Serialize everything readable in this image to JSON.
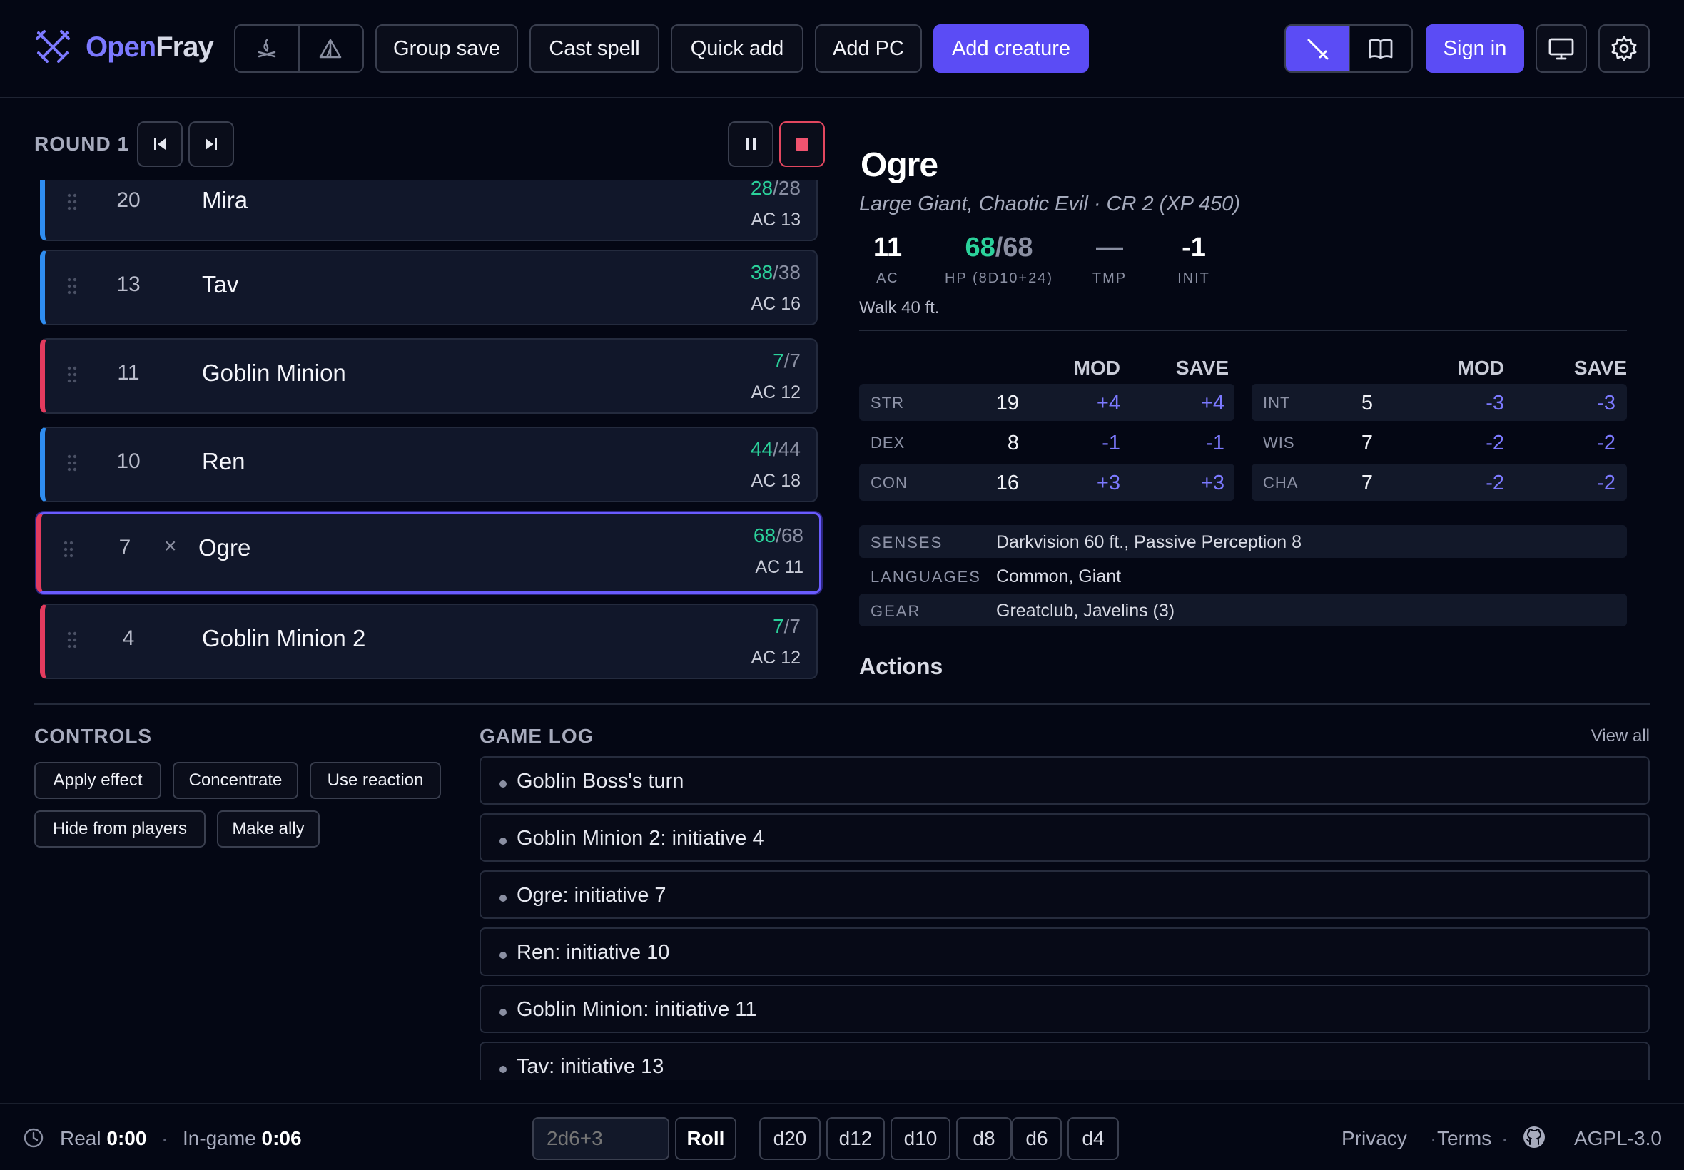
{
  "app": {
    "name_part1": "Open",
    "name_part2": "Fray"
  },
  "header": {
    "group_save": "Group save",
    "cast_spell": "Cast spell",
    "quick_add": "Quick add",
    "add_pc": "Add PC",
    "add_creature": "Add creature",
    "sign_in": "Sign in"
  },
  "tracker": {
    "round_label": "ROUND 1",
    "combatants": [
      {
        "init": "20",
        "name": "Mira",
        "hp": "28",
        "hp_max": "/28",
        "ac": "AC 13",
        "side": "ally"
      },
      {
        "init": "13",
        "name": "Tav",
        "hp": "38",
        "hp_max": "/38",
        "ac": "AC 16",
        "side": "ally"
      },
      {
        "init": "11",
        "name": "Goblin Minion",
        "hp": "7",
        "hp_max": "/7",
        "ac": "AC 12",
        "side": "enemy"
      },
      {
        "init": "10",
        "name": "Ren",
        "hp": "44",
        "hp_max": "/44",
        "ac": "AC 18",
        "side": "ally"
      },
      {
        "init": "7",
        "name": "Ogre",
        "hp": "68",
        "hp_max": "/68",
        "ac": "AC 11",
        "side": "enemy",
        "active": true
      },
      {
        "init": "4",
        "name": "Goblin Minion 2",
        "hp": "7",
        "hp_max": "/7",
        "ac": "AC 12",
        "side": "enemy"
      }
    ],
    "remove_glyph": "×"
  },
  "statblock": {
    "name": "Ogre",
    "subtitle": "Large Giant, Chaotic Evil · CR 2 (XP 450)",
    "ac": "11",
    "ac_label": "AC",
    "hp": "68",
    "hp_max": "/68",
    "hp_label": "HP (8D10+24)",
    "tmp": "—",
    "tmp_label": "TMP",
    "init": "-1",
    "init_label": "INIT",
    "speed": "Walk 40 ft.",
    "mod_header": "MOD",
    "save_header": "SAVE",
    "abilities": [
      {
        "key": "STR",
        "score": "19",
        "mod": "+4",
        "save": "+4"
      },
      {
        "key": "DEX",
        "score": "8",
        "mod": "-1",
        "save": "-1"
      },
      {
        "key": "CON",
        "score": "16",
        "mod": "+3",
        "save": "+3"
      },
      {
        "key": "INT",
        "score": "5",
        "mod": "-3",
        "save": "-3"
      },
      {
        "key": "WIS",
        "score": "7",
        "mod": "-2",
        "save": "-2"
      },
      {
        "key": "CHA",
        "score": "7",
        "mod": "-2",
        "save": "-2"
      }
    ],
    "senses_label": "SENSES",
    "senses": "Darkvision 60 ft., Passive Perception 8",
    "languages_label": "LANGUAGES",
    "languages": "Common, Giant",
    "gear_label": "GEAR",
    "gear": "Greatclub, Javelins (3)",
    "actions_heading": "Actions"
  },
  "controls": {
    "title": "CONTROLS",
    "apply_effect": "Apply effect",
    "concentrate": "Concentrate",
    "use_reaction": "Use reaction",
    "hide_from_players": "Hide from players",
    "make_ally": "Make ally"
  },
  "game_log": {
    "title": "GAME LOG",
    "view_all": "View all",
    "entries": [
      "Goblin Boss's turn",
      "Goblin Minion 2: initiative 4",
      "Ogre: initiative 7",
      "Ren: initiative 10",
      "Goblin Minion: initiative 11",
      "Tav: initiative 13"
    ]
  },
  "footer": {
    "real_label": "Real",
    "real_time": "0:00",
    "sep": "·",
    "ingame_label": "In-game",
    "ingame_time": "0:06",
    "dice_placeholder": "2d6+3",
    "roll": "Roll",
    "dice": [
      "d20",
      "d12",
      "d10",
      "d8",
      "d6",
      "d4"
    ],
    "privacy": "Privacy",
    "terms": "Terms",
    "license": "AGPL-3.0"
  },
  "colors": {
    "accent": "#5b4cf5",
    "hp_green": "#2bd29b",
    "ally": "#2f8df0",
    "enemy": "#e33b5e",
    "mod": "#7c79ff"
  }
}
